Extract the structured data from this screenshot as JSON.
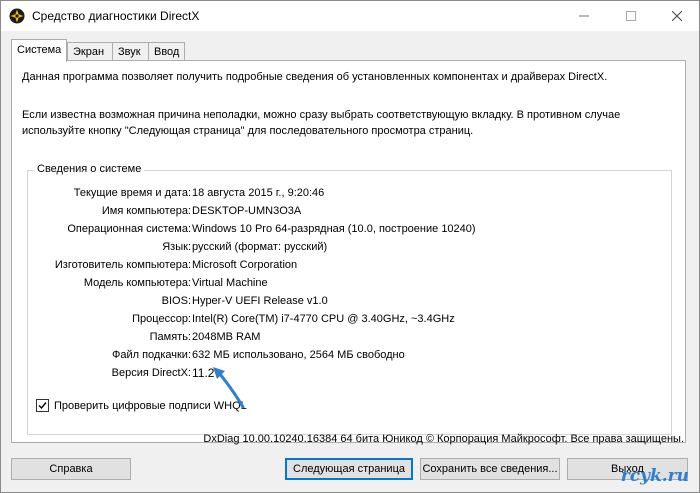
{
  "window": {
    "title": "Средство диагностики DirectX",
    "icons": {
      "app": "directx-icon",
      "minimize": "minimize-icon",
      "maximize": "maximize-icon",
      "close": "close-icon"
    }
  },
  "tabs": [
    {
      "label": "Система",
      "active": true
    },
    {
      "label": "Экран",
      "active": false
    },
    {
      "label": "Звук",
      "active": false
    },
    {
      "label": "Ввод",
      "active": false
    }
  ],
  "intro": {
    "line1": "Данная программа позволяет получить подробные сведения об установленных компонентах и драйверах DirectX.",
    "line2": "Если известна возможная причина неполадки, можно сразу выбрать соответствующую вкладку. В противном случае используйте кнопку \"Следующая страница\" для последовательного просмотра страниц."
  },
  "system_info": {
    "group_title": "Сведения о системе",
    "rows": [
      {
        "label": "Текущие время и дата:",
        "value": "18 августа 2015 г., 9:20:46"
      },
      {
        "label": "Имя компьютера:",
        "value": "DESKTOP-UMN3O3A"
      },
      {
        "label": "Операционная система:",
        "value": "Windows 10 Pro 64-разрядная (10.0, построение 10240)"
      },
      {
        "label": "Язык:",
        "value": "русский (формат: русский)"
      },
      {
        "label": "Изготовитель компьютера:",
        "value": "Microsoft Corporation"
      },
      {
        "label": "Модель компьютера:",
        "value": "Virtual Machine"
      },
      {
        "label": "BIOS:",
        "value": "Hyper-V UEFI Release v1.0"
      },
      {
        "label": "Процессор:",
        "value": "Intel(R) Core(TM) i7-4770 CPU @ 3.40GHz, ~3.4GHz"
      },
      {
        "label": "Память:",
        "value": "2048MB RAM"
      },
      {
        "label": "Файл подкачки:",
        "value": "632 МБ использовано, 2564 МБ свободно"
      },
      {
        "label": "Версия DirectX:",
        "value": "11.2"
      }
    ]
  },
  "whql": {
    "label": "Проверить цифровые подписи WHQL",
    "checked": true
  },
  "footer": "DxDiag 10.00.10240.16384 64 бита Юникод © Корпорация Майкрософт. Все права защищены.",
  "buttons": {
    "help": "Справка",
    "next": "Следующая страница",
    "save": "Сохранить все сведения...",
    "exit": "Выход"
  },
  "watermark": "rcyk.ru",
  "colors": {
    "accent": "#0078d7",
    "arrow": "#2f7fcf"
  }
}
